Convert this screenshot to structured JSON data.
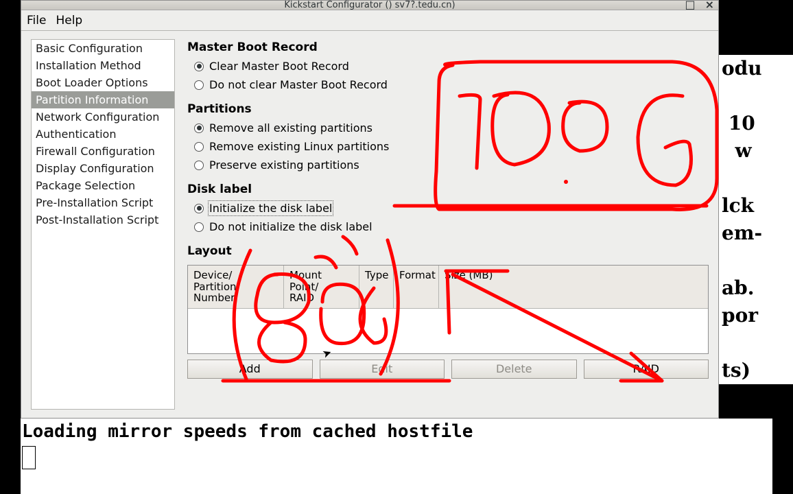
{
  "window": {
    "title": "Kickstart Configurator ()   sv7?.tedu.cn)"
  },
  "menubar": {
    "file": "File",
    "help": "Help"
  },
  "sidebar": {
    "items": [
      {
        "label": "Basic Configuration",
        "selected": false
      },
      {
        "label": "Installation Method",
        "selected": false
      },
      {
        "label": "Boot Loader Options",
        "selected": false
      },
      {
        "label": "Partition Information",
        "selected": true
      },
      {
        "label": "Network Configuration",
        "selected": false
      },
      {
        "label": "Authentication",
        "selected": false
      },
      {
        "label": "Firewall Configuration",
        "selected": false
      },
      {
        "label": "Display Configuration",
        "selected": false
      },
      {
        "label": "Package Selection",
        "selected": false
      },
      {
        "label": "Pre-Installation Script",
        "selected": false
      },
      {
        "label": "Post-Installation Script",
        "selected": false
      }
    ]
  },
  "sections": {
    "mbr": {
      "title": "Master Boot Record",
      "options": [
        {
          "label": "Clear Master Boot Record",
          "checked": true
        },
        {
          "label": "Do not clear Master Boot Record",
          "checked": false
        }
      ]
    },
    "partitions": {
      "title": "Partitions",
      "options": [
        {
          "label": "Remove all existing partitions",
          "checked": true
        },
        {
          "label": "Remove existing Linux partitions",
          "checked": false
        },
        {
          "label": "Preserve existing partitions",
          "checked": false
        }
      ]
    },
    "disklabel": {
      "title": "Disk label",
      "options": [
        {
          "label": "Initialize the disk label",
          "checked": true,
          "focused": true
        },
        {
          "label": "Do not initialize the disk label",
          "checked": false
        }
      ]
    },
    "layout": {
      "title": "Layout",
      "columns": {
        "device": "Device/\nPartition Number",
        "mount": "Mount Point/\nRAID",
        "type": "Type",
        "format": "Format",
        "size": "Size (MB)"
      },
      "rows": []
    }
  },
  "buttons": {
    "add": "Add",
    "edit": "Edit",
    "delete": "Delete",
    "raid": "RAID"
  },
  "terminal": {
    "line1": "Loading mirror speeds from cached hostfile"
  },
  "background_text": "odu\n\n 10\n  w\n\nlck\nem-\n\nab.\npor\n\nts)",
  "annotations": {
    "note_top": "100 G",
    "note_bottom": "80G"
  }
}
